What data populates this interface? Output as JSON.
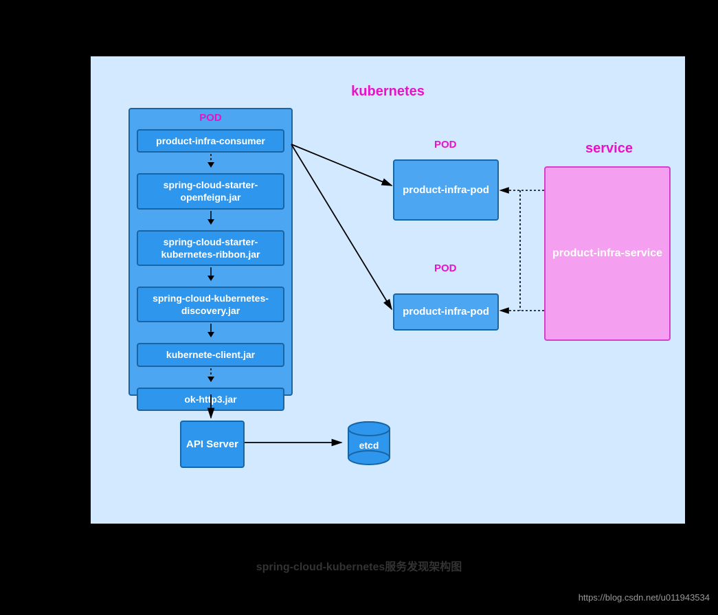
{
  "k8s_title": "kubernetes",
  "pod_container_label": "POD",
  "jars": {
    "consumer": "product-infra-consumer",
    "openfeign": "spring-cloud-starter-openfeign.jar",
    "ribbon": "spring-cloud-starter-kubernetes-ribbon.jar",
    "discovery": "spring-cloud-kubernetes-discovery.jar",
    "client": "kubernete-client.jar",
    "okhttp": "ok-http3.jar"
  },
  "pod_label_1": "POD",
  "pod_label_2": "POD",
  "pod1": "product-infra-pod",
  "pod2": "product-infra-pod",
  "service_label": "service",
  "service_box": "product-infra-service",
  "api_server": "API Server",
  "etcd": "etcd",
  "caption": "spring-cloud-kubernetes服务发现架构图",
  "watermark": "https://blog.csdn.net/u011943534"
}
